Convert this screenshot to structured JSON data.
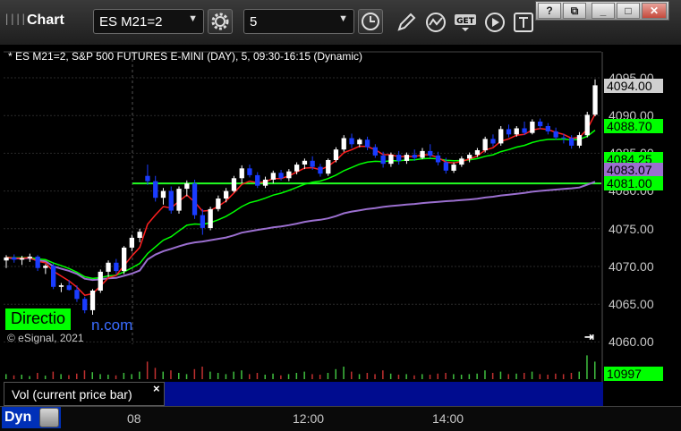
{
  "toolbar": {
    "grip": "||||",
    "title": "Chart",
    "symbol": "ES M21=2",
    "interval": "5",
    "icons": [
      "settings-gear-icon",
      "clock-icon",
      "pencil-icon",
      "indicator-icon",
      "get-icon",
      "play-icon",
      "text-icon"
    ]
  },
  "window_buttons": [
    "?",
    "⧉",
    "_",
    "□",
    "✕"
  ],
  "chart": {
    "info_line": "* ES M21=2, S&P 500 FUTURES E-MINI (DAY), 5, 09:30-16:15 (Dynamic)",
    "price_ticks": [
      "4095.00",
      "4090.00",
      "4085.00",
      "4080.00",
      "4075.00",
      "4070.00",
      "4065.00",
      "4060.00"
    ],
    "badges": [
      {
        "label": "4094.00",
        "color": "#cfcfcf",
        "text": "#000000"
      },
      {
        "label": "4088.70",
        "color": "#00ff00",
        "text": "#000000"
      },
      {
        "label": "4084.25",
        "color": "#00ff00",
        "text": "#000000"
      },
      {
        "label": "4083.07",
        "color": "#9b6fcf",
        "text": "#000000"
      },
      {
        "label": "4081.00",
        "color": "#00ff00",
        "text": "#000000"
      }
    ],
    "watermark": {
      "boxed": "Directio",
      "tail": "n.com"
    },
    "copyright": "© eSignal, 2021",
    "goto_end": "⇥",
    "colors": {
      "up": "#ffffff",
      "down": "#1a3cff",
      "ema_red": "#ff2020",
      "ema_green": "#00ff00",
      "vwap": "#9b6fcf",
      "flat": "#22ff22"
    },
    "candles": [
      [
        4070.8,
        4071.5,
        4069.8,
        4071.2
      ],
      [
        4071.2,
        4071.6,
        4070.5,
        4070.9
      ],
      [
        4070.9,
        4071.4,
        4070.2,
        4071.1
      ],
      [
        4071.1,
        4071.7,
        4070.6,
        4071.3
      ],
      [
        4071.3,
        4071.5,
        4069.4,
        4069.8
      ],
      [
        4069.8,
        4070.3,
        4069.0,
        4070.1
      ],
      [
        4070.1,
        4070.4,
        4067.0,
        4067.3
      ],
      [
        4067.3,
        4067.8,
        4066.6,
        4067.5
      ],
      [
        4067.5,
        4068.2,
        4066.8,
        4066.9
      ],
      [
        4066.9,
        4067.5,
        4065.3,
        4065.7
      ],
      [
        4065.7,
        4066.0,
        4063.8,
        4064.2
      ],
      [
        4064.2,
        4067.0,
        4063.6,
        4066.8
      ],
      [
        4066.8,
        4069.6,
        4066.5,
        4069.3
      ],
      [
        4069.3,
        4070.8,
        4068.6,
        4070.5
      ],
      [
        4070.5,
        4071.0,
        4069.0,
        4069.4
      ],
      [
        4069.4,
        4072.7,
        4069.0,
        4072.5
      ],
      [
        4072.5,
        4074.2,
        4072.0,
        4073.8
      ],
      [
        4073.8,
        4075.0,
        4073.2,
        4074.6
      ],
      [
        4082.0,
        4083.5,
        4080.8,
        4081.3
      ],
      [
        4081.3,
        4082.0,
        4078.6,
        4079.1
      ],
      [
        4079.1,
        4080.4,
        4078.2,
        4080.0
      ],
      [
        4080.0,
        4080.6,
        4077.0,
        4077.4
      ],
      [
        4077.4,
        4080.6,
        4077.0,
        4080.3
      ],
      [
        4080.3,
        4081.4,
        4079.3,
        4081.0
      ],
      [
        4081.0,
        4081.5,
        4076.3,
        4076.8
      ],
      [
        4076.8,
        4077.6,
        4074.2,
        4075.1
      ],
      [
        4075.1,
        4077.9,
        4074.8,
        4077.6
      ],
      [
        4077.6,
        4079.4,
        4077.3,
        4079.0
      ],
      [
        4079.0,
        4080.4,
        4078.5,
        4080.0
      ],
      [
        4080.0,
        4082.0,
        4079.8,
        4081.7
      ],
      [
        4081.7,
        4083.4,
        4081.0,
        4083.0
      ],
      [
        4083.0,
        4083.5,
        4081.8,
        4082.1
      ],
      [
        4082.1,
        4082.5,
        4080.4,
        4080.7
      ],
      [
        4080.7,
        4081.9,
        4080.4,
        4081.5
      ],
      [
        4081.5,
        4082.7,
        4081.0,
        4082.4
      ],
      [
        4082.4,
        4082.8,
        4081.4,
        4081.7
      ],
      [
        4081.7,
        4082.9,
        4081.3,
        4082.6
      ],
      [
        4082.6,
        4083.8,
        4082.2,
        4083.5
      ],
      [
        4083.5,
        4084.3,
        4082.9,
        4084.0
      ],
      [
        4084.0,
        4084.6,
        4082.8,
        4083.2
      ],
      [
        4083.2,
        4083.6,
        4081.9,
        4082.3
      ],
      [
        4082.3,
        4084.3,
        4082.0,
        4084.1
      ],
      [
        4084.1,
        4085.8,
        4083.8,
        4085.5
      ],
      [
        4085.5,
        4087.4,
        4085.2,
        4087.0
      ],
      [
        4087.0,
        4087.6,
        4085.7,
        4086.2
      ],
      [
        4086.2,
        4087.0,
        4085.8,
        4086.8
      ],
      [
        4086.8,
        4087.2,
        4085.4,
        4085.8
      ],
      [
        4085.8,
        4086.2,
        4084.4,
        4084.7
      ],
      [
        4084.7,
        4085.2,
        4083.1,
        4083.6
      ],
      [
        4083.6,
        4085.1,
        4083.2,
        4084.8
      ],
      [
        4084.8,
        4085.3,
        4083.5,
        4084.0
      ],
      [
        4084.0,
        4085.1,
        4083.6,
        4084.8
      ],
      [
        4084.8,
        4085.5,
        4084.0,
        4084.4
      ],
      [
        4084.4,
        4085.7,
        4084.2,
        4085.3
      ],
      [
        4085.3,
        4086.2,
        4084.3,
        4084.7
      ],
      [
        4084.7,
        4085.2,
        4083.4,
        4083.8
      ],
      [
        4083.8,
        4084.4,
        4082.3,
        4082.7
      ],
      [
        4082.7,
        4083.8,
        4082.4,
        4083.5
      ],
      [
        4083.5,
        4084.6,
        4083.2,
        4084.3
      ],
      [
        4084.3,
        4085.1,
        4083.8,
        4084.8
      ],
      [
        4084.8,
        4085.7,
        4084.5,
        4085.4
      ],
      [
        4085.4,
        4087.2,
        4085.1,
        4086.9
      ],
      [
        4086.9,
        4087.5,
        4085.9,
        4086.3
      ],
      [
        4086.3,
        4088.6,
        4086.0,
        4088.2
      ],
      [
        4088.2,
        4088.8,
        4087.1,
        4087.5
      ],
      [
        4087.5,
        4088.6,
        4087.2,
        4088.3
      ],
      [
        4088.3,
        4089.2,
        4087.4,
        4087.7
      ],
      [
        4087.7,
        4089.5,
        4087.5,
        4089.2
      ],
      [
        4089.2,
        4089.6,
        4088.2,
        4088.6
      ],
      [
        4088.6,
        4089.0,
        4087.5,
        4087.9
      ],
      [
        4087.9,
        4088.4,
        4086.8,
        4087.1
      ],
      [
        4087.1,
        4087.6,
        4086.3,
        4087.0
      ],
      [
        4087.0,
        4087.4,
        4085.6,
        4086.0
      ],
      [
        4086.0,
        4087.8,
        4085.7,
        4087.4
      ],
      [
        4087.4,
        4090.5,
        4087.1,
        4090.1
      ],
      [
        4090.1,
        4094.8,
        4089.9,
        4094.0
      ]
    ],
    "vol_badge": "10997",
    "vol_label": "Vol (current price bar)",
    "vol_close": "×",
    "volumes": [
      0.2,
      0.15,
      0.18,
      0.12,
      0.25,
      0.14,
      0.3,
      0.2,
      0.16,
      0.22,
      0.35,
      0.28,
      0.2,
      0.18,
      0.15,
      0.25,
      0.2,
      0.3,
      0.7,
      0.45,
      0.3,
      0.35,
      0.25,
      0.2,
      0.4,
      0.5,
      0.3,
      0.25,
      0.2,
      0.3,
      0.35,
      0.2,
      0.25,
      0.18,
      0.22,
      0.15,
      0.2,
      0.25,
      0.3,
      0.2,
      0.18,
      0.25,
      0.4,
      0.5,
      0.3,
      0.2,
      0.25,
      0.2,
      0.35,
      0.22,
      0.18,
      0.2,
      0.15,
      0.2,
      0.18,
      0.22,
      0.25,
      0.2,
      0.18,
      0.2,
      0.22,
      0.35,
      0.25,
      0.3,
      0.2,
      0.22,
      0.25,
      0.3,
      0.2,
      0.18,
      0.22,
      0.2,
      0.25,
      0.3,
      0.95,
      0.7
    ],
    "x_ticks": [
      "08",
      "12:00",
      "14:00"
    ],
    "dyn_label": "Dyn"
  }
}
